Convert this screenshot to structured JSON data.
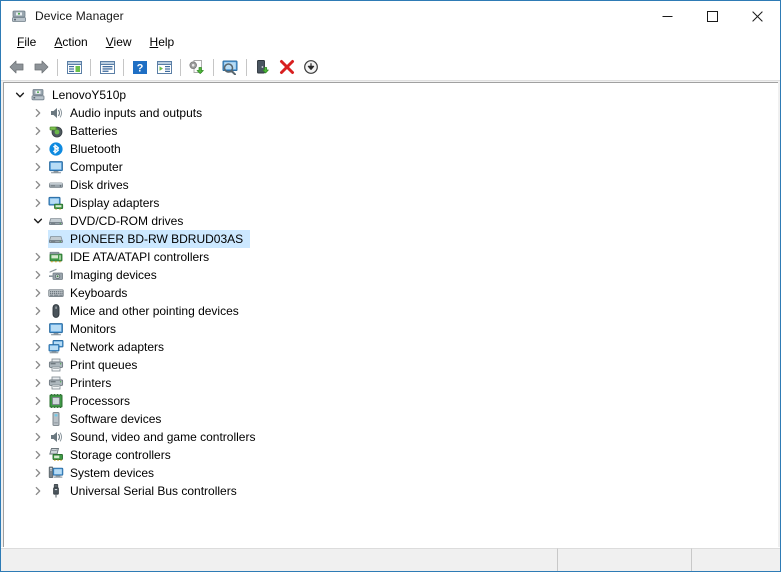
{
  "window": {
    "title": "Device Manager",
    "icon": "device-manager-icon",
    "border_color": "#2e7bb5",
    "caption_buttons": [
      {
        "name": "minimize",
        "glyph": "minimize-icon"
      },
      {
        "name": "maximize",
        "glyph": "maximize-icon"
      },
      {
        "name": "close",
        "glyph": "close-icon"
      }
    ]
  },
  "menubar": {
    "items": [
      {
        "label": "File",
        "accesskey": "F"
      },
      {
        "label": "Action",
        "accesskey": "A"
      },
      {
        "label": "View",
        "accesskey": "V"
      },
      {
        "label": "Help",
        "accesskey": "H"
      }
    ]
  },
  "toolbar": {
    "buttons": [
      {
        "name": "back-button",
        "icon": "back-arrow-icon",
        "title": "Back"
      },
      {
        "name": "forward-button",
        "icon": "forward-arrow-icon",
        "title": "Forward"
      },
      {
        "name": "separator-1",
        "icon": "separator"
      },
      {
        "name": "show-hide-console-tree-button",
        "icon": "console-tree-icon",
        "title": "Show/Hide Console Tree"
      },
      {
        "name": "separator-2",
        "icon": "separator"
      },
      {
        "name": "properties-button",
        "icon": "properties-icon",
        "title": "Properties"
      },
      {
        "name": "separator-3",
        "icon": "separator"
      },
      {
        "name": "help-button",
        "icon": "help-question-icon",
        "title": "Help"
      },
      {
        "name": "show-hide-action-pane-button",
        "icon": "action-pane-icon",
        "title": "Show/Hide Action Pane"
      },
      {
        "name": "separator-4",
        "icon": "separator"
      },
      {
        "name": "update-driver-button",
        "icon": "update-driver-icon",
        "title": "Update Driver Software"
      },
      {
        "name": "separator-5",
        "icon": "separator"
      },
      {
        "name": "scan-hardware-changes-button",
        "icon": "scan-hardware-icon",
        "title": "Scan for hardware changes"
      },
      {
        "name": "separator-6",
        "icon": "separator"
      },
      {
        "name": "enable-device-button",
        "icon": "enable-device-icon",
        "title": "Enable device"
      },
      {
        "name": "uninstall-device-button",
        "icon": "uninstall-red-x-icon",
        "title": "Uninstall device"
      },
      {
        "name": "disable-device-button",
        "icon": "disable-device-icon",
        "title": "Disable device"
      }
    ]
  },
  "tree": {
    "root": {
      "label": "LenovoY510p",
      "icon": "computer-root-icon",
      "expanded": true,
      "depth": 0
    },
    "nodes": [
      {
        "label": "Audio inputs and outputs",
        "icon": "speaker-icon",
        "expanded": false,
        "depth": 1,
        "selected": false
      },
      {
        "label": "Batteries",
        "icon": "battery-icon",
        "expanded": false,
        "depth": 1,
        "selected": false
      },
      {
        "label": "Bluetooth",
        "icon": "bluetooth-icon",
        "expanded": false,
        "depth": 1,
        "selected": false
      },
      {
        "label": "Computer",
        "icon": "monitor-icon",
        "expanded": false,
        "depth": 1,
        "selected": false
      },
      {
        "label": "Disk drives",
        "icon": "disk-drive-icon",
        "expanded": false,
        "depth": 1,
        "selected": false
      },
      {
        "label": "Display adapters",
        "icon": "display-adapter-icon",
        "expanded": false,
        "depth": 1,
        "selected": false
      },
      {
        "label": "DVD/CD-ROM drives",
        "icon": "dvd-drive-icon",
        "expanded": true,
        "depth": 1,
        "selected": false
      },
      {
        "label": "PIONEER BD-RW  BDRUD03AS",
        "icon": "dvd-drive-icon",
        "expanded": null,
        "depth": 2,
        "selected": true
      },
      {
        "label": "IDE ATA/ATAPI controllers",
        "icon": "ide-controller-icon",
        "expanded": false,
        "depth": 1,
        "selected": false
      },
      {
        "label": "Imaging devices",
        "icon": "camera-icon",
        "expanded": false,
        "depth": 1,
        "selected": false
      },
      {
        "label": "Keyboards",
        "icon": "keyboard-icon",
        "expanded": false,
        "depth": 1,
        "selected": false
      },
      {
        "label": "Mice and other pointing devices",
        "icon": "mouse-icon",
        "expanded": false,
        "depth": 1,
        "selected": false
      },
      {
        "label": "Monitors",
        "icon": "monitor-icon",
        "expanded": false,
        "depth": 1,
        "selected": false
      },
      {
        "label": "Network adapters",
        "icon": "network-adapter-icon",
        "expanded": false,
        "depth": 1,
        "selected": false
      },
      {
        "label": "Print queues",
        "icon": "printer-icon",
        "expanded": false,
        "depth": 1,
        "selected": false
      },
      {
        "label": "Printers",
        "icon": "printer-icon",
        "expanded": false,
        "depth": 1,
        "selected": false
      },
      {
        "label": "Processors",
        "icon": "processor-icon",
        "expanded": false,
        "depth": 1,
        "selected": false
      },
      {
        "label": "Software devices",
        "icon": "software-device-icon",
        "expanded": false,
        "depth": 1,
        "selected": false
      },
      {
        "label": "Sound, video and game controllers",
        "icon": "speaker-icon",
        "expanded": false,
        "depth": 1,
        "selected": false
      },
      {
        "label": "Storage controllers",
        "icon": "storage-controller-icon",
        "expanded": false,
        "depth": 1,
        "selected": false
      },
      {
        "label": "System devices",
        "icon": "system-device-icon",
        "expanded": false,
        "depth": 1,
        "selected": false
      },
      {
        "label": "Universal Serial Bus controllers",
        "icon": "usb-icon",
        "expanded": false,
        "depth": 1,
        "selected": false
      }
    ]
  },
  "statusbar": {
    "panes": [
      {
        "text": ""
      },
      {
        "text": ""
      },
      {
        "text": ""
      }
    ]
  },
  "colors": {
    "selection": "#cce8ff",
    "window_border": "#2e7bb5",
    "chrome": "#f0f0f0"
  }
}
